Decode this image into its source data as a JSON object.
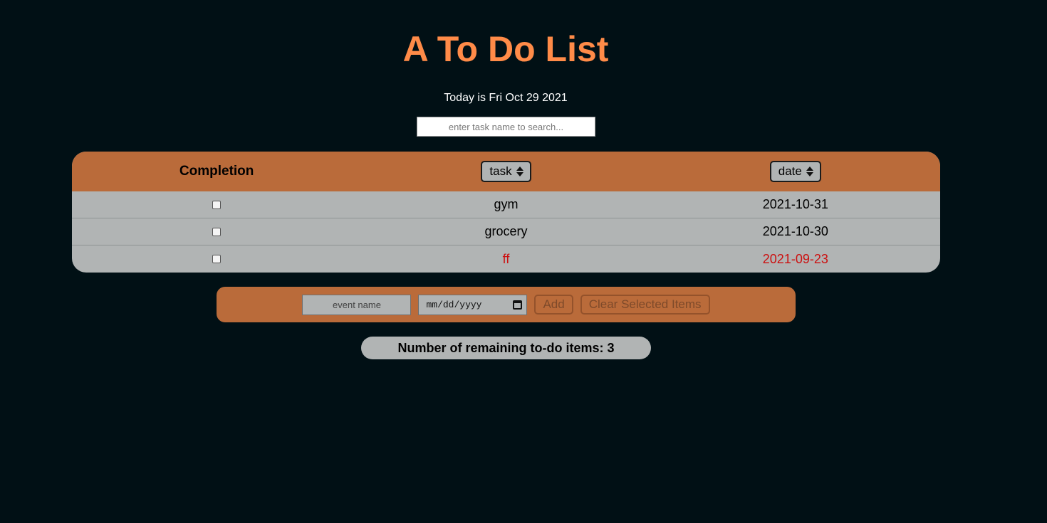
{
  "header": {
    "title": "A To Do List",
    "today_text": "Today is Fri Oct 29 2021"
  },
  "search": {
    "placeholder": "enter task name to search..."
  },
  "table": {
    "columns": {
      "completion": "Completion",
      "task": "task",
      "date": "date"
    },
    "rows": [
      {
        "task": "gym",
        "date": "2021-10-31",
        "completed": false,
        "overdue": false
      },
      {
        "task": "grocery",
        "date": "2021-10-30",
        "completed": false,
        "overdue": false
      },
      {
        "task": "ff",
        "date": "2021-09-23",
        "completed": false,
        "overdue": true
      }
    ]
  },
  "add_form": {
    "event_placeholder": "event name",
    "date_placeholder": "mm/dd/yyyy",
    "add_label": "Add",
    "clear_label": "Clear Selected Items"
  },
  "footer": {
    "remaining_label": "Number of remaining to-do items:",
    "remaining_count": "3"
  },
  "colors": {
    "background": "#011015",
    "title": "#ff8b48",
    "accent": "#ba6b3a",
    "panel": "#b1b4b4",
    "overdue": "#cc1010"
  },
  "icons": {
    "sort": "sort-updown-icon",
    "calendar": "calendar-icon"
  }
}
